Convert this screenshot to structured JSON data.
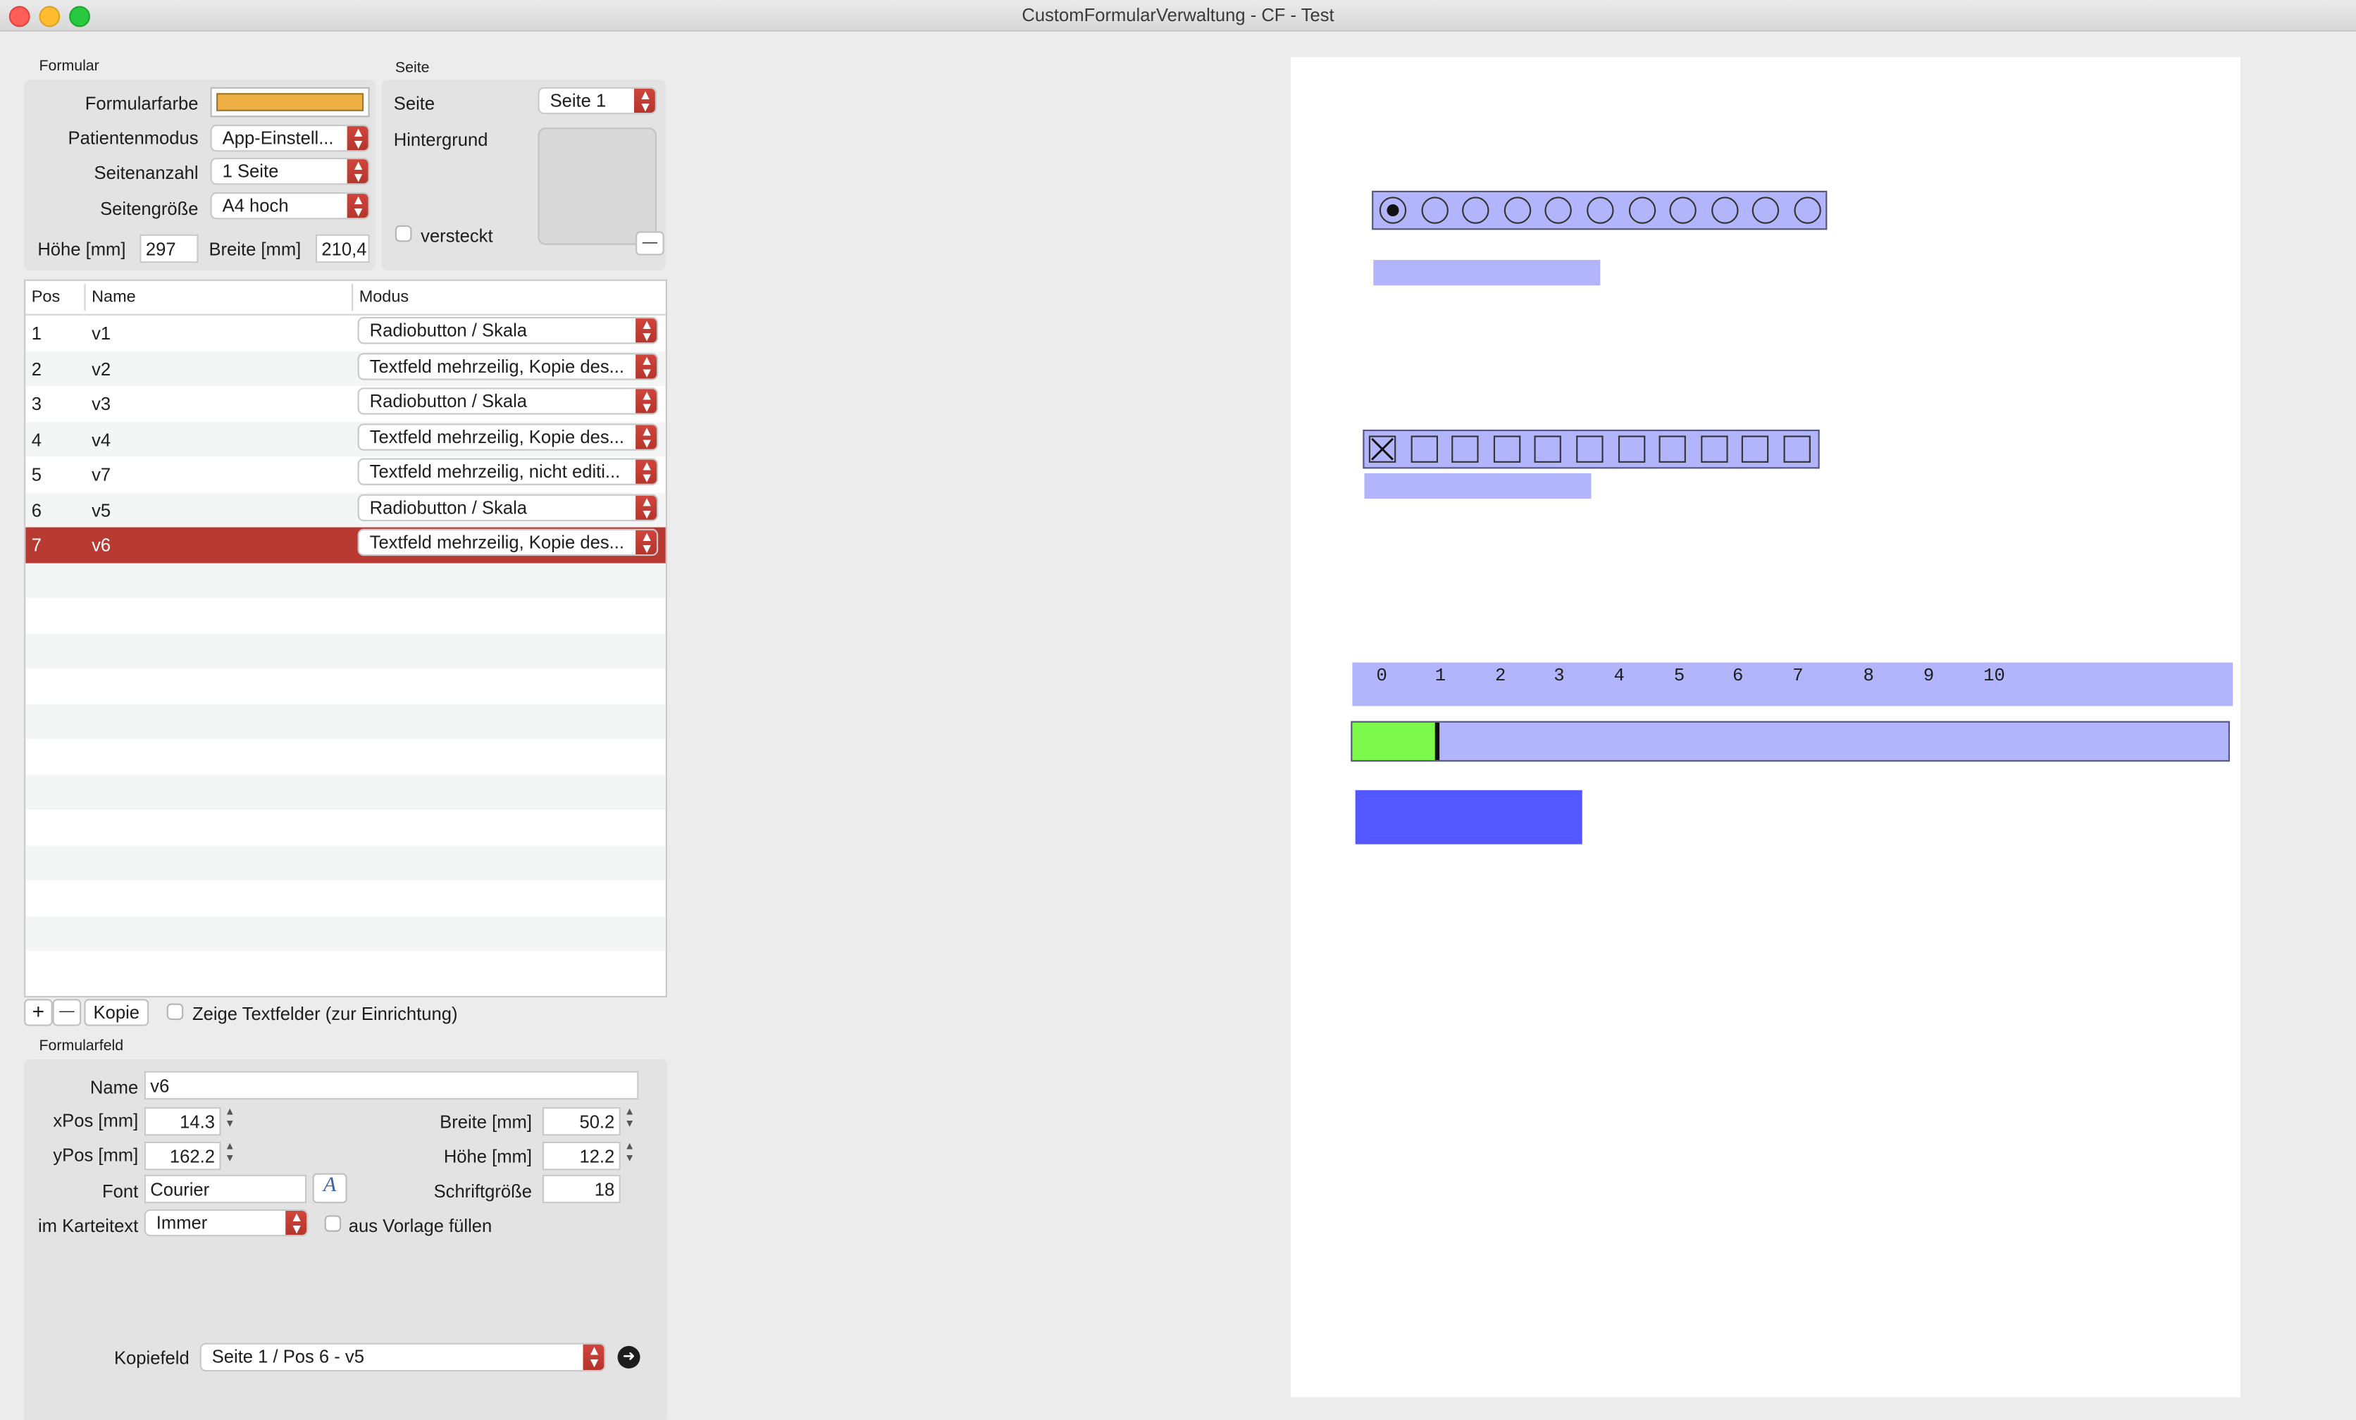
{
  "window": {
    "title": "CustomFormularVerwaltung - CF - Test"
  },
  "formular": {
    "section_label": "Formular",
    "color_label": "Formularfarbe",
    "color_value": "#eeb045",
    "patient_mode_label": "Patientenmodus",
    "patient_mode_value": "App-Einstell...",
    "page_count_label": "Seitenanzahl",
    "page_count_value": "1 Seite",
    "page_size_label": "Seitengröße",
    "page_size_value": "A4 hoch",
    "height_label": "Höhe [mm]",
    "height_value": "297",
    "width_label": "Breite [mm]",
    "width_value": "210,4"
  },
  "seite": {
    "section_label": "Seite",
    "page_label": "Seite",
    "page_value": "Seite 1",
    "background_label": "Hintergrund",
    "hidden_label": "versteckt"
  },
  "table": {
    "columns": [
      "Pos",
      "Name",
      "Modus"
    ],
    "rows": [
      {
        "pos": "1",
        "name": "v1",
        "mode": "Radiobutton / Skala"
      },
      {
        "pos": "2",
        "name": "v2",
        "mode": "Textfeld mehrzeilig, Kopie des..."
      },
      {
        "pos": "3",
        "name": "v3",
        "mode": "Radiobutton / Skala"
      },
      {
        "pos": "4",
        "name": "v4",
        "mode": "Textfeld mehrzeilig, Kopie des..."
      },
      {
        "pos": "5",
        "name": "v7",
        "mode": "Textfeld mehrzeilig, nicht editi..."
      },
      {
        "pos": "6",
        "name": "v5",
        "mode": "Radiobutton / Skala"
      },
      {
        "pos": "7",
        "name": "v6",
        "mode": "Textfeld mehrzeilig, Kopie des..."
      }
    ]
  },
  "toolbar": {
    "add_label": "+",
    "remove_label": "—",
    "copy_label": "Kopie",
    "show_textfields_label": "Zeige Textfelder (zur Einrichtung)"
  },
  "formularfeld": {
    "section_label": "Formularfeld",
    "name_label": "Name",
    "name_value": "v6",
    "xpos_label": "xPos [mm]",
    "xpos_value": "14.3",
    "ypos_label": "yPos [mm]",
    "ypos_value": "162.2",
    "width_label": "Breite [mm]",
    "width_value": "50.2",
    "height_label": "Höhe [mm]",
    "height_value": "12.2",
    "font_label": "Font",
    "font_value": "Courier",
    "fontsize_label": "Schriftgröße",
    "fontsize_value": "18",
    "karteitext_label": "im Karteitext",
    "karteitext_value": "Immer",
    "template_label": "aus Vorlage füllen",
    "copyfield_label": "Kopiefeld",
    "copyfield_value": "Seite 1 / Pos 6 - v5"
  },
  "preview": {
    "scale_ticks": [
      "0",
      "1",
      "2",
      "3",
      "4",
      "5",
      "6",
      "7",
      "8",
      "9",
      "10"
    ],
    "slider_fraction": 0.1,
    "radio_count": 11,
    "radio_selected_index": 0,
    "checkbox_count": 11,
    "checkbox_checked_index": 0
  }
}
